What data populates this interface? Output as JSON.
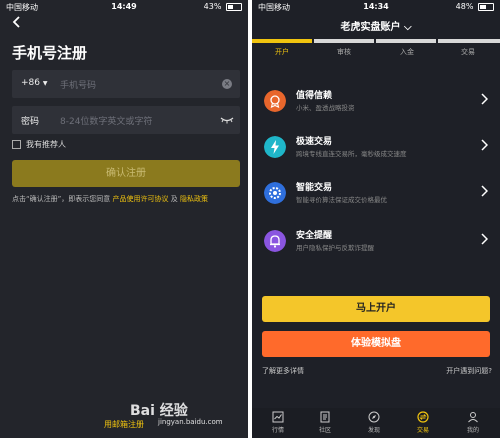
{
  "left": {
    "status": {
      "carrier": "中国移动",
      "time": "14:49",
      "battery": "43%"
    },
    "title": "手机号注册",
    "phone": {
      "code": "+86",
      "placeholder": "手机号码"
    },
    "password": {
      "label": "密码",
      "placeholder": "8-24位数字英文或字符"
    },
    "referrer_label": "我有推荐人",
    "confirm_label": "确认注册",
    "terms": {
      "prefix": "点击“确认注册”，即表示您同意",
      "agreement": "产品使用许可协议",
      "and": "及",
      "privacy": "隐私政策"
    },
    "email_register": "用邮箱注册"
  },
  "right": {
    "status": {
      "carrier": "中国移动",
      "time": "14:34",
      "battery": "48%"
    },
    "title": "老虎实盘账户",
    "steps": [
      "开户",
      "审核",
      "入金",
      "交易"
    ],
    "features": [
      {
        "title": "值得信赖",
        "subtitle": "小米、盈透战略投资",
        "icon": "medal-icon",
        "color": "#e8662c"
      },
      {
        "title": "极速交易",
        "subtitle": "跨境专线直连交易所，毫秒级成交速度",
        "icon": "lightning-icon",
        "color": "#1fb6c9"
      },
      {
        "title": "智能交易",
        "subtitle": "智能寻价算法保证成交价格最优",
        "icon": "gear-icon",
        "color": "#2f6fdc"
      },
      {
        "title": "安全提醒",
        "subtitle": "用户隐私保护与反欺诈提醒",
        "icon": "bell-icon",
        "color": "#8a55e0"
      }
    ],
    "open_account": "马上开户",
    "demo_account": "体验模拟盘",
    "learn_more": "了解更多详情",
    "problems": "开户遇到问题?",
    "nav": [
      "行情",
      "社区",
      "发现",
      "交易",
      "我的"
    ]
  },
  "watermark": {
    "brand": "Bai 经验",
    "url": "jingyan.baidu.com"
  },
  "colors": {
    "accent": "#f1c40f",
    "orange": "#ff6a2b",
    "bg": "#23252b"
  }
}
